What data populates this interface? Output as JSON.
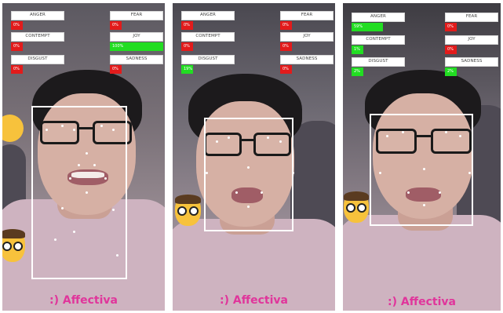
{
  "panels": [
    {
      "metrics": {
        "anger": {
          "label": "ANGER",
          "value": "0%",
          "fraction": 0.0
        },
        "contempt": {
          "label": "CONTEMPT",
          "value": "0%",
          "fraction": 0.0
        },
        "disgust": {
          "label": "DISGUST",
          "value": "0%",
          "fraction": 0.0
        },
        "fear": {
          "label": "FEAR",
          "value": "0%",
          "fraction": 0.0
        },
        "joy": {
          "label": "JOY",
          "value": "100%",
          "fraction": 1.0
        },
        "sadness": {
          "label": "SADNESS",
          "value": "0%",
          "fraction": 0.0
        }
      },
      "watermark": ":) Affectiva",
      "emojis": [
        "kissing-emoji",
        "glasses-nerd-emoji"
      ]
    },
    {
      "metrics": {
        "anger": {
          "label": "ANGER",
          "value": "0%",
          "fraction": 0.0
        },
        "contempt": {
          "label": "CONTEMPT",
          "value": "0%",
          "fraction": 0.0
        },
        "disgust": {
          "label": "DISGUST",
          "value": "19%",
          "fraction": 0.19
        },
        "fear": {
          "label": "FEAR",
          "value": "0%",
          "fraction": 0.0
        },
        "joy": {
          "label": "JOY",
          "value": "0%",
          "fraction": 0.0
        },
        "sadness": {
          "label": "SADNESS",
          "value": "0%",
          "fraction": 0.0
        }
      },
      "watermark": ":) Affectiva",
      "emojis": [
        "glasses-nerd-emoji"
      ]
    },
    {
      "metrics": {
        "anger": {
          "label": "ANGER",
          "value": "59%",
          "fraction": 0.59
        },
        "contempt": {
          "label": "CONTEMPT",
          "value": "1%",
          "fraction": 0.01
        },
        "disgust": {
          "label": "DISGUST",
          "value": "2%",
          "fraction": 0.02
        },
        "fear": {
          "label": "FEAR",
          "value": "0%",
          "fraction": 0.0
        },
        "joy": {
          "label": "JOY",
          "value": "0%",
          "fraction": 0.0
        },
        "sadness": {
          "label": "SADNESS",
          "value": "2%",
          "fraction": 0.02
        }
      },
      "watermark": ":) Affectiva",
      "emojis": [
        "glasses-nerd-emoji"
      ]
    }
  ],
  "colors": {
    "positive": "#22dd22",
    "zero": "#e21b1b",
    "brand": "#e0359b"
  }
}
